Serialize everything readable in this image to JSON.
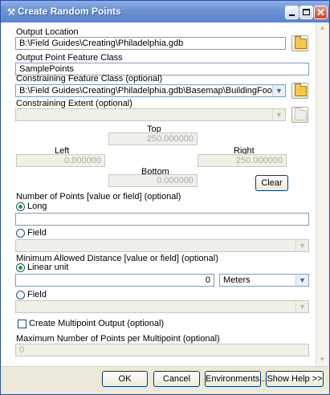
{
  "window": {
    "title": "Create Random Points"
  },
  "fields": {
    "output_location": {
      "label": "Output Location",
      "value": "B:\\Field Guides\\Creating\\Philadelphia.gdb"
    },
    "output_feature_class": {
      "label": "Output Point Feature Class",
      "value": "SamplePoints"
    },
    "constraining_feature_class": {
      "label": "Constraining Feature Class (optional)",
      "value": "B:\\Field Guides\\Creating\\Philadelphia.gdb\\Basemap\\BuildingFootprints"
    },
    "constraining_extent": {
      "label": "Constraining Extent (optional)",
      "value": ""
    }
  },
  "extent": {
    "top_label": "Top",
    "top": "250.000000",
    "left_label": "Left",
    "left": "0.000000",
    "right_label": "Right",
    "right": "250.000000",
    "bottom_label": "Bottom",
    "bottom": "0.000000",
    "clear_label": "Clear"
  },
  "num_points": {
    "label": "Number of Points [value or field] (optional)",
    "long_label": "Long",
    "long_value": "",
    "field_label": "Field",
    "field_value": ""
  },
  "min_distance": {
    "label": "Minimum Allowed Distance [value or field] (optional)",
    "linear_label": "Linear unit",
    "linear_value": "0",
    "unit": "Meters",
    "field_label": "Field",
    "field_value": ""
  },
  "multipoint": {
    "checkbox_label": "Create Multipoint Output (optional)",
    "max_label": "Maximum Number of Points per Multipoint (optional)",
    "max_value": "0"
  },
  "buttons": {
    "ok": "OK",
    "cancel": "Cancel",
    "environments": "Environments...",
    "show_help": "Show Help >>"
  },
  "icons": {
    "title": "tool-icon",
    "browse": "folder-open-icon"
  }
}
